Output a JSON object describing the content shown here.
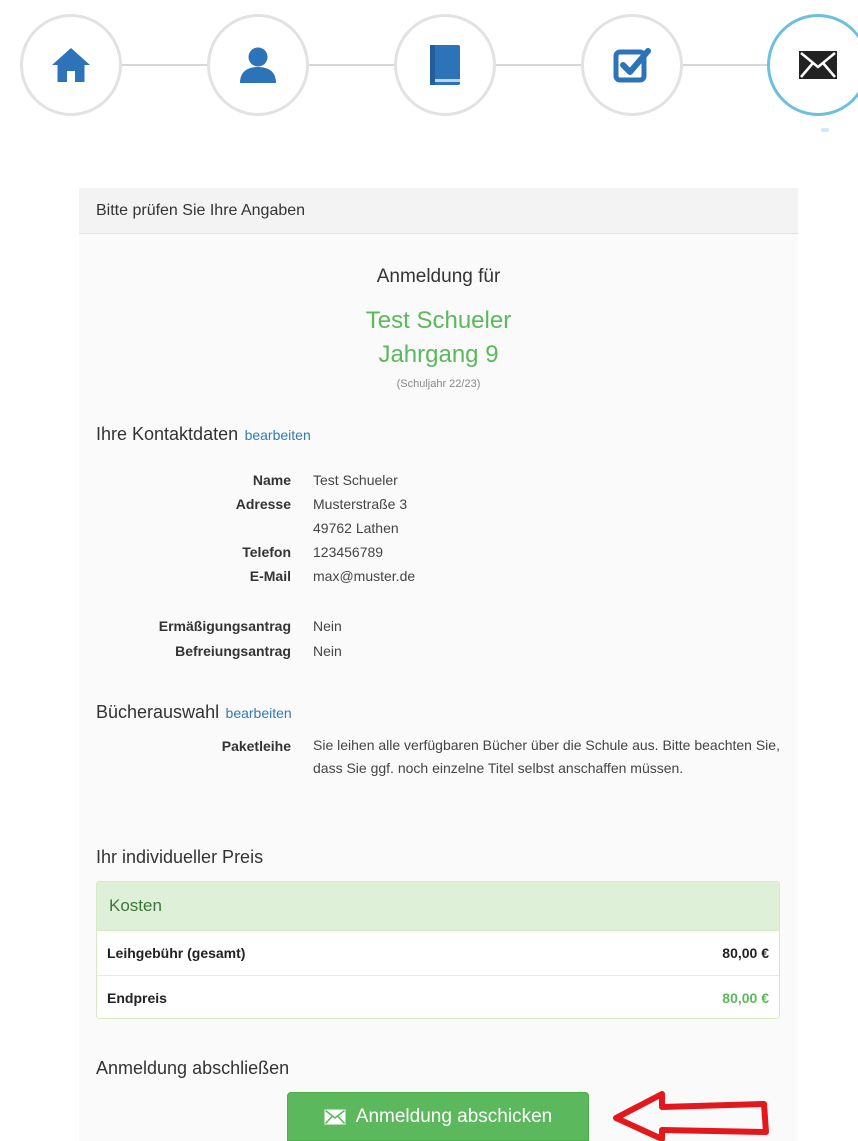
{
  "stepper": {
    "steps": [
      {
        "icon": "home-icon"
      },
      {
        "icon": "user-icon"
      },
      {
        "icon": "book-icon"
      },
      {
        "icon": "checkbox-icon"
      },
      {
        "icon": "envelope-icon",
        "active": true
      }
    ],
    "icon_color": "#2d73b8",
    "active_border_color": "#6cc0dd"
  },
  "panel": {
    "heading": "Bitte prüfen Sie Ihre Angaben",
    "registration_for": "Anmeldung für",
    "student_name": "Test Schueler",
    "grade": "Jahrgang 9",
    "school_year": "(Schuljahr 22/23)"
  },
  "contact": {
    "title": "Ihre Kontaktdaten",
    "edit_label": "bearbeiten",
    "fields": {
      "name_label": "Name",
      "name_value": "Test Schueler",
      "address_label": "Adresse",
      "address_line1": "Musterstraße 3",
      "address_line2": "49762 Lathen",
      "phone_label": "Telefon",
      "phone_value": "123456789",
      "email_label": "E-Mail",
      "email_value": "max@muster.de",
      "reduction_label": "Ermäßigungsantrag",
      "reduction_value": "Nein",
      "exemption_label": "Befreiungsantrag",
      "exemption_value": "Nein"
    }
  },
  "books": {
    "title": "Bücherauswahl",
    "edit_label": "bearbeiten",
    "package_label": "Paketleihe",
    "package_description": "Sie leihen alle verfügbaren Bücher über die Schule aus. Bitte beachten Sie, dass Sie ggf. noch einzelne Titel selbst anschaffen müssen."
  },
  "price": {
    "title": "Ihr individueller Preis",
    "box_heading": "Kosten",
    "rows": [
      {
        "label": "Leihgebühr (gesamt)",
        "value": "80,00 €"
      },
      {
        "label": "Endpreis",
        "value": "80,00 €"
      }
    ],
    "accent_color": "#5cb85c"
  },
  "finish": {
    "title": "Anmeldung abschließen",
    "submit_label": "Anmeldung abschicken"
  },
  "annotation": {
    "arrow_color": "#e3171c"
  }
}
